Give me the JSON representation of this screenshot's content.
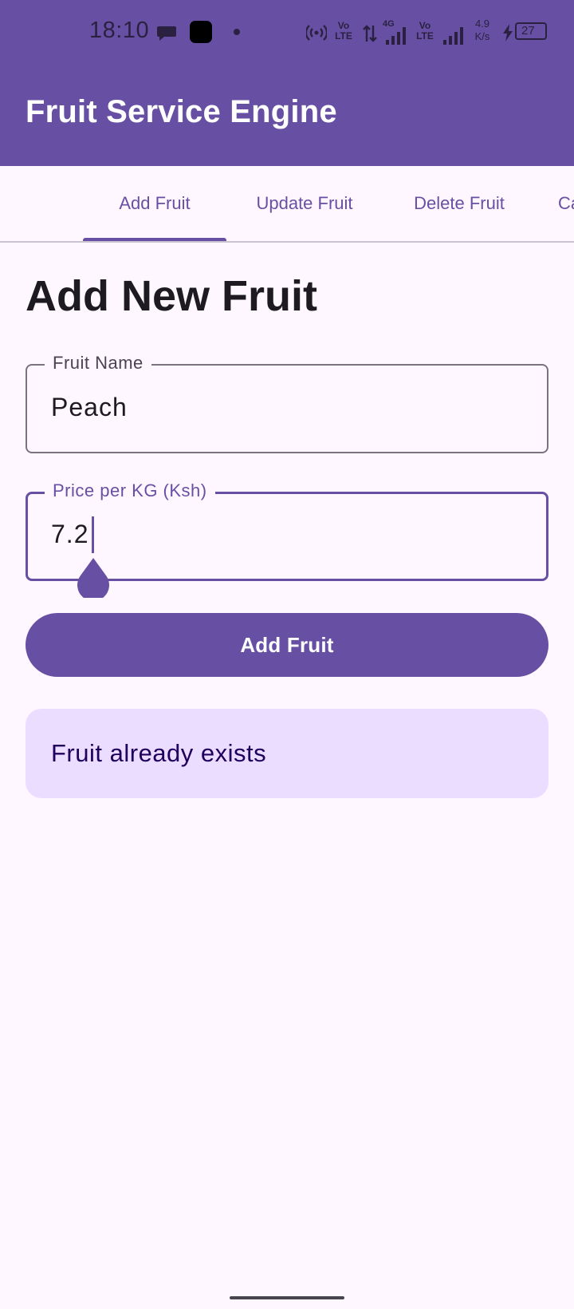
{
  "status_bar": {
    "time": "18:10",
    "volte_1": "Vo LTE",
    "network_label": "4G",
    "volte_2": "Vo LTE",
    "net_speed_value": "4.9",
    "net_speed_unit": "K/s",
    "battery": "27",
    "icons": [
      "chat-icon",
      "app-icon",
      "dot-icon",
      "hotspot-icon",
      "data-arrows-icon",
      "signal-icon",
      "signal-icon",
      "charging-icon",
      "battery-icon"
    ]
  },
  "app_bar": {
    "title": "Fruit Service Engine"
  },
  "tabs": [
    {
      "label": "Add Fruit",
      "selected": true
    },
    {
      "label": "Update Fruit",
      "selected": false
    },
    {
      "label": "Delete Fruit",
      "selected": false
    },
    {
      "label": "Ca",
      "selected": false
    }
  ],
  "form": {
    "title": "Add New Fruit",
    "fruit_name": {
      "label": "Fruit Name",
      "value": "Peach"
    },
    "price": {
      "label": "Price per KG (Ksh)",
      "value": "7.2"
    },
    "submit_label": "Add Fruit"
  },
  "message": {
    "text": "Fruit already exists"
  },
  "colors": {
    "primary": "#6750A4",
    "background": "#FEF7FF",
    "message_container": "#EADDFF",
    "on_message": "#21005D"
  }
}
